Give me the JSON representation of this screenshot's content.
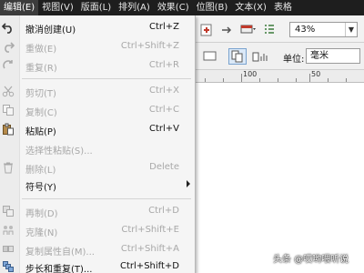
{
  "menubar": {
    "items": [
      "编辑(E)",
      "视图(V)",
      "版面(L)",
      "排列(A)",
      "效果(C)",
      "位图(B)",
      "文本(X)",
      "表格"
    ]
  },
  "toolbar": {
    "zoom_value": "43%",
    "unit_label": "单位:",
    "unit_value": "毫米"
  },
  "ruler": {
    "labels": [
      "100",
      "50"
    ]
  },
  "edit_menu": {
    "items": [
      {
        "label": "撤消创建(U)",
        "shortcut": "Ctrl+Z",
        "enabled": true,
        "icon": "undo-icon"
      },
      {
        "label": "重做(E)",
        "shortcut": "Ctrl+Shift+Z",
        "enabled": false,
        "icon": "redo-icon"
      },
      {
        "label": "重复(R)",
        "shortcut": "Ctrl+R",
        "enabled": false,
        "icon": "repeat-icon"
      },
      {
        "label": "剪切(T)",
        "shortcut": "Ctrl+X",
        "enabled": false,
        "icon": "scissors-icon"
      },
      {
        "label": "复制(C)",
        "shortcut": "Ctrl+C",
        "enabled": false,
        "icon": "copy-icon"
      },
      {
        "label": "粘贴(P)",
        "shortcut": "Ctrl+V",
        "enabled": true,
        "icon": "paste-icon"
      },
      {
        "label": "选择性粘贴(S)...",
        "shortcut": "",
        "enabled": false,
        "icon": ""
      },
      {
        "label": "删除(L)",
        "shortcut": "Delete",
        "enabled": false,
        "icon": "trash-icon"
      },
      {
        "label": "符号(Y)",
        "shortcut": "",
        "enabled": true,
        "icon": ""
      },
      {
        "label": "再制(D)",
        "shortcut": "Ctrl+D",
        "enabled": false,
        "icon": "duplicate-icon"
      },
      {
        "label": "克隆(N)",
        "shortcut": "Ctrl+Shift+E",
        "enabled": false,
        "icon": "clone-icon"
      },
      {
        "label": "复制属性自(M)...",
        "shortcut": "Ctrl+Shift+A",
        "enabled": false,
        "icon": "copy-properties-icon"
      },
      {
        "label": "步长和重复(T)...",
        "shortcut": "Ctrl+Shift+D",
        "enabled": true,
        "icon": "step-repeat-icon"
      }
    ]
  },
  "watermark": "头条 @哎哟喂听说"
}
